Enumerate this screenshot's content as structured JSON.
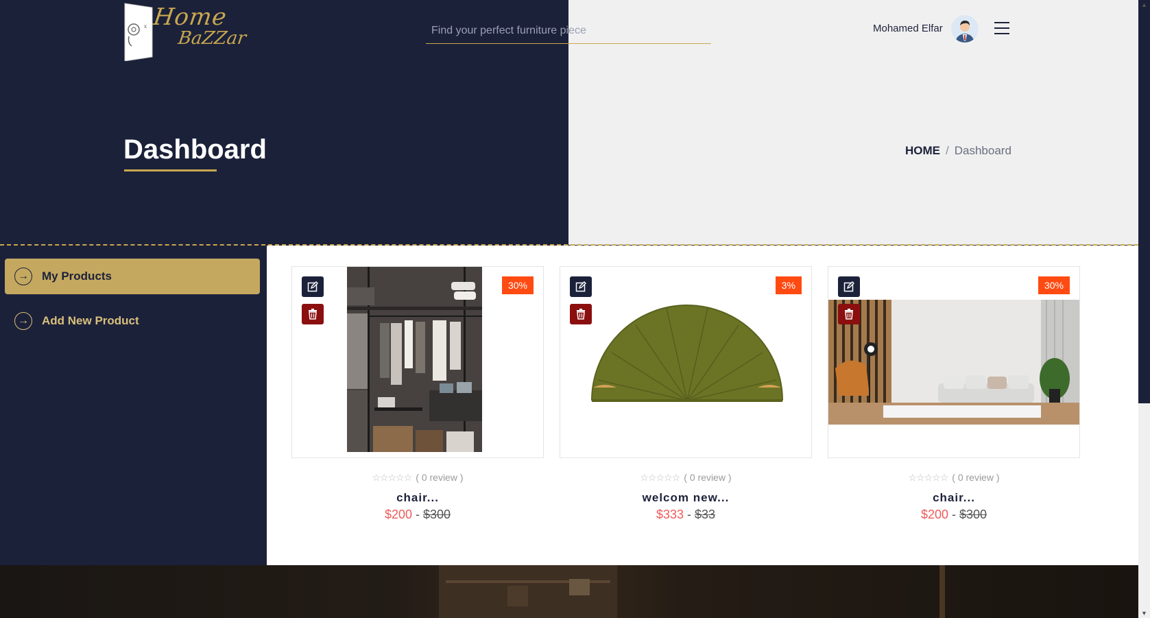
{
  "brand": {
    "line1": "Home",
    "line2": "BaZZar",
    "accent": "#c9a94f",
    "navy": "#1c213a"
  },
  "search": {
    "placeholder": "Find your perfect furniture piece"
  },
  "user": {
    "name": "Mohamed Elfar"
  },
  "header": {
    "title": "Dashboard"
  },
  "breadcrumb": {
    "home": "HOME",
    "separator": "/",
    "current": "Dashboard"
  },
  "sidebar": {
    "items": [
      {
        "label": "My Products",
        "active": true
      },
      {
        "label": "Add New Product",
        "active": false
      }
    ]
  },
  "products": [
    {
      "name": "chair...",
      "discount": "30%",
      "stars": "☆☆☆☆☆",
      "reviews": "( 0 review )",
      "price": "$200",
      "sep": "-",
      "old_price": "$300",
      "image": "wardrobe"
    },
    {
      "name": "welcom new...",
      "discount": "3%",
      "stars": "☆☆☆☆☆",
      "reviews": "( 0 review )",
      "price": "$333",
      "sep": "-",
      "old_price": "$33",
      "image": "green-headboard"
    },
    {
      "name": "chair...",
      "discount": "30%",
      "stars": "☆☆☆☆☆",
      "reviews": "( 0 review )",
      "price": "$200",
      "sep": "-",
      "old_price": "$300",
      "image": "living-room"
    }
  ]
}
